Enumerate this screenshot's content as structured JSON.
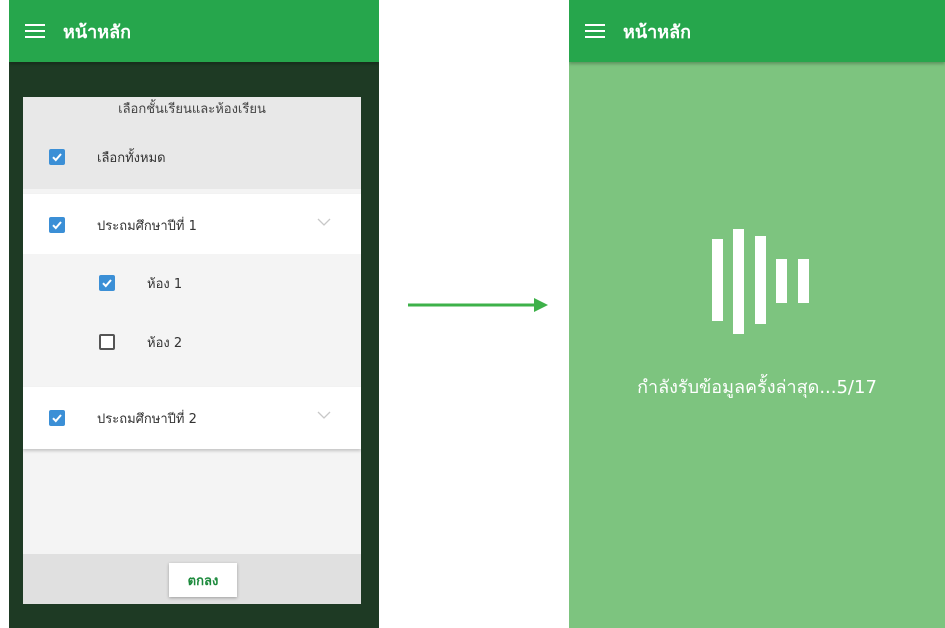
{
  "left_screen": {
    "appbar": {
      "title": "หน้าหลัก",
      "menu_icon": "hamburger-menu-icon"
    },
    "dialog": {
      "title": "เลือกชั้นเรียนและห้องเรียน",
      "select_all": {
        "label": "เลือกทั้งหมด",
        "checked": true
      },
      "grades": [
        {
          "label": "ประถมศึกษาปีที่ 1",
          "checked": true,
          "expanded": true,
          "rooms": [
            {
              "label": "ห้อง 1",
              "checked": true
            },
            {
              "label": "ห้อง 2",
              "checked": false
            }
          ]
        },
        {
          "label": "ประถมศึกษาปีที่ 2",
          "checked": true,
          "expanded": false
        }
      ],
      "ok_label": "ตกลง"
    }
  },
  "right_screen": {
    "appbar": {
      "title": "หน้าหลัก",
      "menu_icon": "hamburger-menu-icon"
    },
    "loading_text": "กำลังรับข้อมูลครั้งล่าสุด...5/17"
  },
  "colors": {
    "appbar": "#26a64c",
    "loading_background": "#7dc47f",
    "checkbox_checked": "#3b8fd6",
    "ok_text": "#1c8a3c",
    "arrow": "#3db149"
  }
}
